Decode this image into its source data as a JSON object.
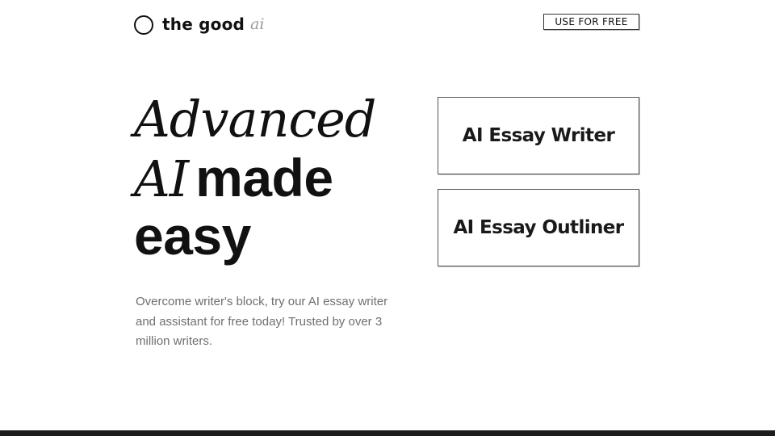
{
  "header": {
    "brand_name": "the good",
    "brand_suffix": "ai",
    "cta_label": "USE FOR FREE"
  },
  "hero": {
    "title_line1_italic": "Advanced",
    "title_line2_italic": "AI",
    "title_line2_bold": "made",
    "title_line3_bold": "easy",
    "description": "Overcome writer's block, try our AI essay writer and assistant for free today! Trusted by over 3 million writers."
  },
  "tools": [
    {
      "label": "AI Essay Writer"
    },
    {
      "label": "AI Essay Outliner"
    }
  ]
}
